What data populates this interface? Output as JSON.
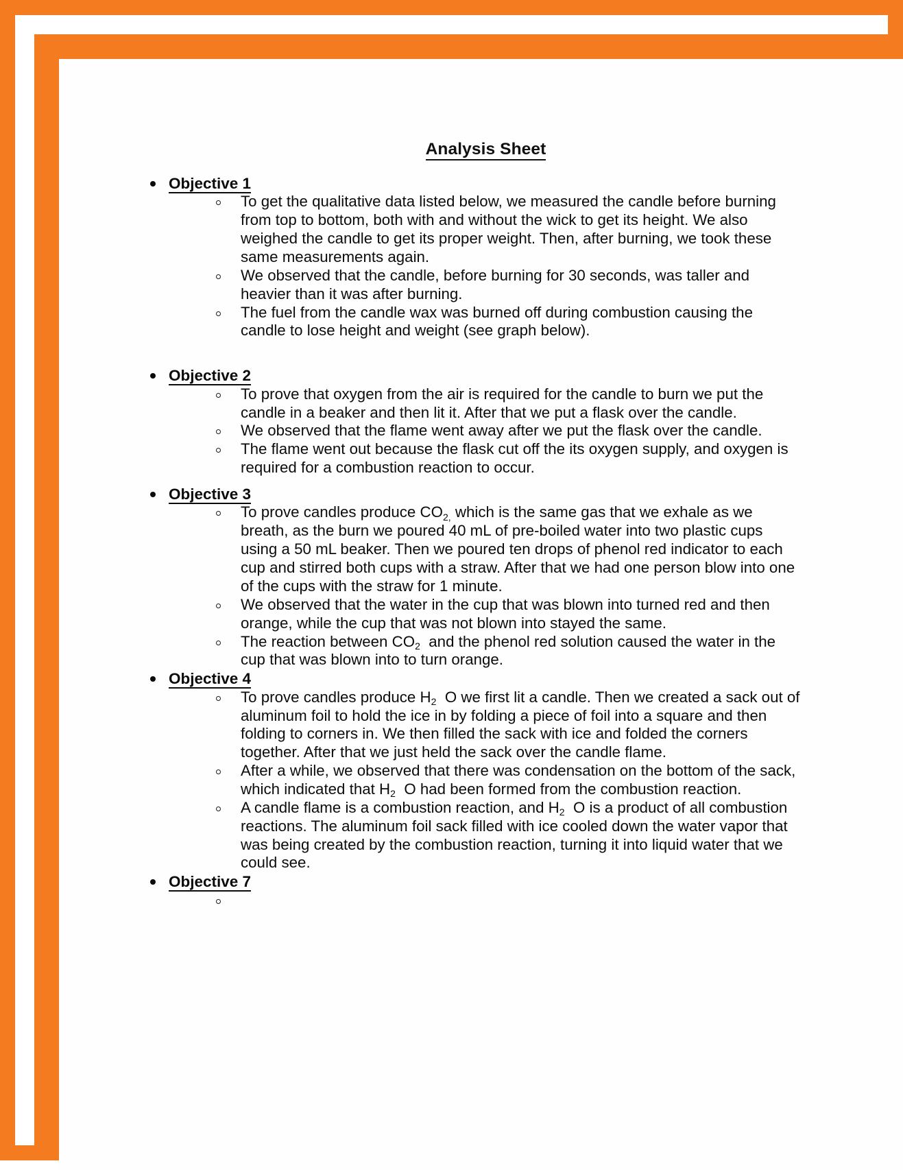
{
  "page": {
    "border_color": "#f47b20",
    "paper_color": "#fefefe",
    "text_color": "#0c0c0c",
    "title": "Analysis Sheet"
  },
  "document": {
    "title": "Analysis Sheet",
    "objectives": [
      {
        "label": "Objective 1",
        "points": [
          "To get the qualitative data listed below, we measured the candle before burning from top to bottom, both with and without the wick to get its height. We also weighed the candle to get its proper weight. Then, after burning, we took these same measurements again.",
          "We observed that the candle, before burning for 30 seconds, was taller and heavier than it was after burning.",
          "The fuel from the candle wax was burned off during combustion causing the candle to lose height and weight (see graph below)."
        ]
      },
      {
        "label": "Objective 2",
        "points": [
          "To prove that oxygen from the air is required for the candle to burn we put the candle in a beaker and then lit it. After that we put a flask over the candle.",
          "We observed that the flame went away after we put the flask over the candle.",
          " The flame went out because the flask cut off the its oxygen supply, and oxygen is required for a combustion reaction to occur."
        ]
      },
      {
        "label": "Objective 3",
        "points_html": [
          "To prove candles produce CO<sub>2,</sub> which is the same gas that we exhale as we breath, as the burn we poured 40 mL of pre-boiled water into two plastic cups using a 50 mL beaker. Then we poured ten drops of phenol red indicator to each cup and stirred both cups with a straw. After that we had one person blow into one of the cups with the straw for 1 minute.",
          "We observed that the water in the cup that was blown into turned red and then orange, while the cup that was not blown into stayed the same.",
          "The reaction between CO<sub>2</sub>&nbsp; and the phenol red solution caused the water in the cup that was blown into to turn orange."
        ]
      },
      {
        "label": "Objective 4",
        "points_html": [
          "To prove candles produce H<sub>2</sub>&nbsp; O we first lit a candle. Then we created a sack out of aluminum foil to hold the ice in by folding a piece of foil into a square and then folding to corners in. We then filled the sack with ice and folded the corners together. After that we just held the sack over the candle flame.",
          "After a while, we observed that there was condensation on the bottom of the sack, which indicated that H<sub>2</sub>&nbsp; O had been formed from the combustion reaction.",
          "A candle flame is a combustion reaction, and H<sub>2</sub>&nbsp; O is a product of all combustion reactions. The aluminum foil sack filled with ice cooled down the water vapor that was being created by the combustion reaction, turning it into liquid water that we could see."
        ]
      },
      {
        "label": "Objective 7",
        "points_html": [
          ""
        ]
      }
    ]
  }
}
